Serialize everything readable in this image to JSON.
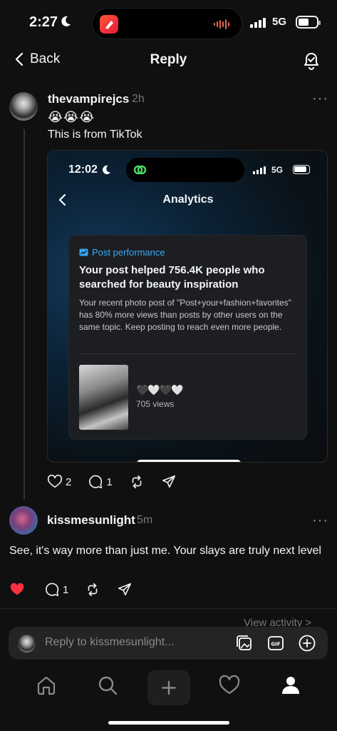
{
  "status_bar": {
    "time": "2:27",
    "network": "5G"
  },
  "nav": {
    "back_label": "Back",
    "title": "Reply"
  },
  "post": {
    "username": "thevampirejcs",
    "time": "2h",
    "more": "···",
    "emoji_line": "😭😭😭",
    "text": "This is from TikTok",
    "likes": "2",
    "replies": "1"
  },
  "embed": {
    "time": "12:02",
    "network": "5G",
    "title": "Analytics",
    "card": {
      "label": "Post performance",
      "headline": "Your post helped 756.4K people who searched for beauty inspiration",
      "body": "Your recent photo post of \"Post+your+fashion+favorites\" has 80% more views than posts by other users on the same topic. Keep posting to reach even more people.",
      "hearts": "🖤🤍🖤🤍",
      "views": "705 views"
    }
  },
  "reply": {
    "username": "kissmesunlight",
    "time": "5m",
    "more": "···",
    "text": "See, it's way more than just me. Your slays are truly next level",
    "replies": "1"
  },
  "view_activity": "View activity >",
  "composer": {
    "placeholder": "Reply to kissmesunlight..."
  },
  "colors": {
    "background": "#101010",
    "accent_blue": "#37aaf5",
    "like_red": "#ff3040"
  }
}
